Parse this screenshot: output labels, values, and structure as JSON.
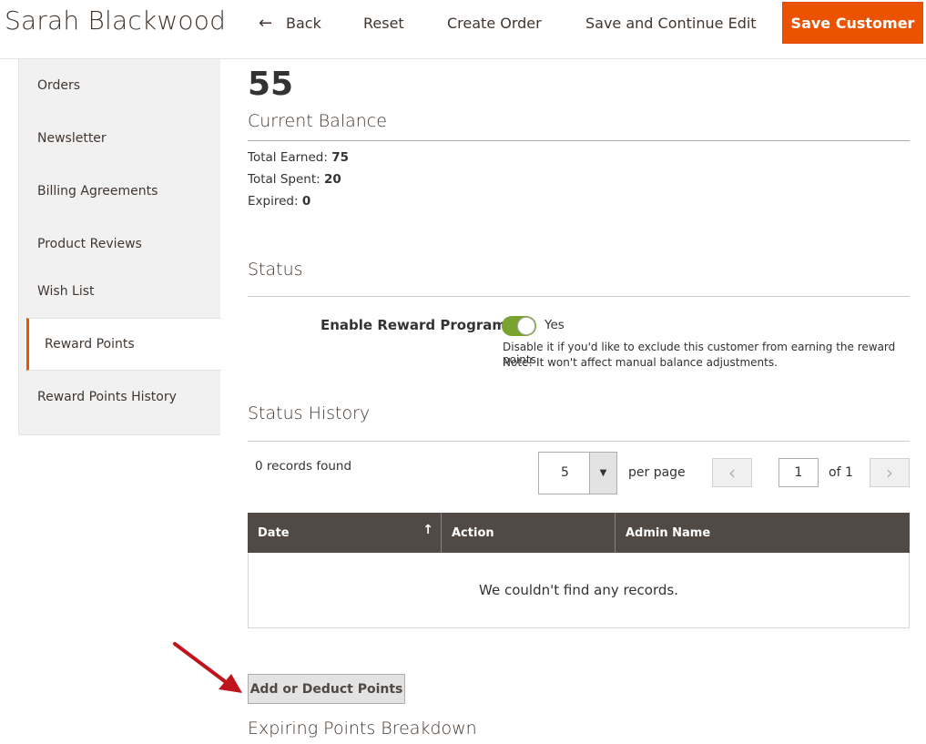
{
  "header": {
    "title": "Sarah Blackwood",
    "back_label": "Back",
    "reset_label": "Reset",
    "create_order_label": "Create Order",
    "save_continue_label": "Save and Continue Edit",
    "save_customer_label": "Save Customer"
  },
  "sidebar": {
    "items": [
      {
        "label": "Orders"
      },
      {
        "label": "Newsletter"
      },
      {
        "label": "Billing Agreements"
      },
      {
        "label": "Product Reviews"
      },
      {
        "label": "Wish List"
      },
      {
        "label": "Reward Points"
      },
      {
        "label": "Reward Points History"
      }
    ],
    "active": "Reward Points"
  },
  "balance": {
    "amount": "55",
    "title": "Current Balance",
    "total_earned_label": "Total Earned:",
    "total_earned": "75",
    "total_spent_label": "Total Spent:",
    "total_spent": "20",
    "expired_label": "Expired:",
    "expired": "0"
  },
  "status": {
    "title": "Status",
    "field_label": "Enable Reward Program",
    "toggle_on": true,
    "toggle_text": "Yes",
    "note_line1": "Disable it if you'd like to exclude this customer from earning the reward points.",
    "note_line2": "Note! It won't affect manual balance adjustments."
  },
  "history": {
    "title": "Status History",
    "records_found": "0 records found",
    "per_page_value": "5",
    "per_page_label": "per page",
    "current_page": "1",
    "of_pages": "of 1",
    "columns": [
      "Date",
      "Action",
      "Admin Name"
    ],
    "empty_text": "We couldn't find any records."
  },
  "actions": {
    "add_deduct_label": "Add or Deduct Points"
  },
  "expiring": {
    "title": "Expiring Points Breakdown"
  },
  "colors": {
    "accent": "#eb5202",
    "grid_header": "#514943",
    "toggle_on": "#79a22e",
    "annotation_arrow": "#c0141c"
  }
}
